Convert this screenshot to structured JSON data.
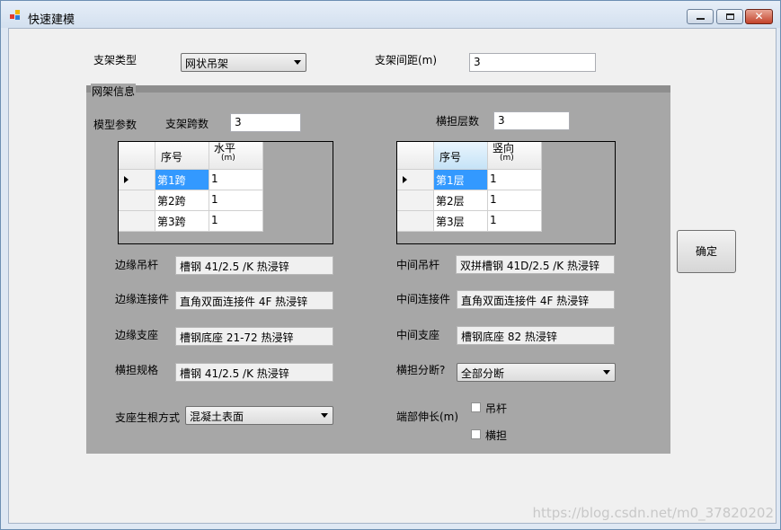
{
  "window": {
    "title": "快速建模",
    "icon": "app-icon"
  },
  "top": {
    "support_type_label": "支架类型",
    "support_type_value": "网状吊架",
    "spacing_label": "支架间距(m)",
    "spacing_value": "3"
  },
  "group": {
    "title": "网架信息",
    "model_params_label": "模型参数",
    "span_count_label": "支架跨数",
    "span_count_value": "3",
    "layer_count_label": "横担层数",
    "layer_count_value": "3",
    "span_grid": {
      "col_index": "序号",
      "col_value_line1": "水平",
      "col_value_line2": "(m)",
      "rows": [
        {
          "index": "第1跨",
          "value": "1"
        },
        {
          "index": "第2跨",
          "value": "1"
        },
        {
          "index": "第3跨",
          "value": "1"
        }
      ]
    },
    "layer_grid": {
      "col_index": "序号",
      "col_value_line1": "竖向",
      "col_value_line2": "(m)",
      "rows": [
        {
          "index": "第1层",
          "value": "1"
        },
        {
          "index": "第2层",
          "value": "1"
        },
        {
          "index": "第3层",
          "value": "1"
        }
      ]
    },
    "edge_rod_label": "边缘吊杆",
    "edge_rod_value": "槽钢 41/2.5 /K 热浸锌",
    "mid_rod_label": "中间吊杆",
    "mid_rod_value": "双拼槽钢 41D/2.5 /K 热浸锌",
    "edge_conn_label": "边缘连接件",
    "edge_conn_value": "直角双面连接件 4F 热浸锌",
    "mid_conn_label": "中间连接件",
    "mid_conn_value": "直角双面连接件 4F 热浸锌",
    "edge_base_label": "边缘支座",
    "edge_base_value": "槽钢底座 21-72 热浸锌",
    "mid_base_label": "中间支座",
    "mid_base_value": "槽钢底座 82 热浸锌",
    "crossarm_spec_label": "横担规格",
    "crossarm_spec_value": "槽钢 41/2.5 /K 热浸锌",
    "crossarm_break_label": "横担分断?",
    "crossarm_break_value": "全部分断",
    "root_method_label": "支座生根方式",
    "root_method_value": "混凝土表面",
    "end_extend_label": "端部伸长(m)",
    "chk_rod_label": "吊杆",
    "chk_crossarm_label": "横担"
  },
  "confirm_label": "确定",
  "watermark": "https://blog.csdn.net/m0_37820202"
}
